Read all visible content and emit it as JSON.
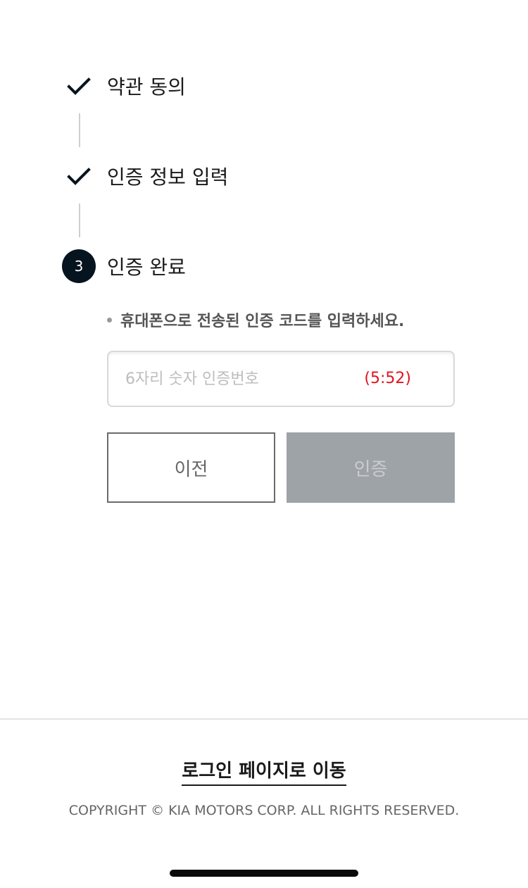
{
  "steps": [
    {
      "label": "약관 동의",
      "status": "done",
      "icon": "check-icon"
    },
    {
      "label": "인증 정보 입력",
      "status": "done",
      "icon": "check-icon"
    },
    {
      "label": "인증 완료",
      "status": "current",
      "number": "3"
    }
  ],
  "verification": {
    "instruction": "휴대폰으로 전송된 인증 코드를 입력하세요.",
    "code_placeholder": "6자리 숫자 인증번호",
    "code_value": "",
    "timer": "(5:52)"
  },
  "buttons": {
    "prev_label": "이전",
    "verify_label": "인증"
  },
  "footer": {
    "login_link": "로그인 페이지로 이동",
    "copyright": "COPYRIGHT © KIA MOTORS CORP. ALL RIGHTS RESERVED."
  },
  "colors": {
    "brand_dark": "#05141f",
    "timer_red": "#e0141e",
    "disabled_button": "#9ea3a8"
  }
}
